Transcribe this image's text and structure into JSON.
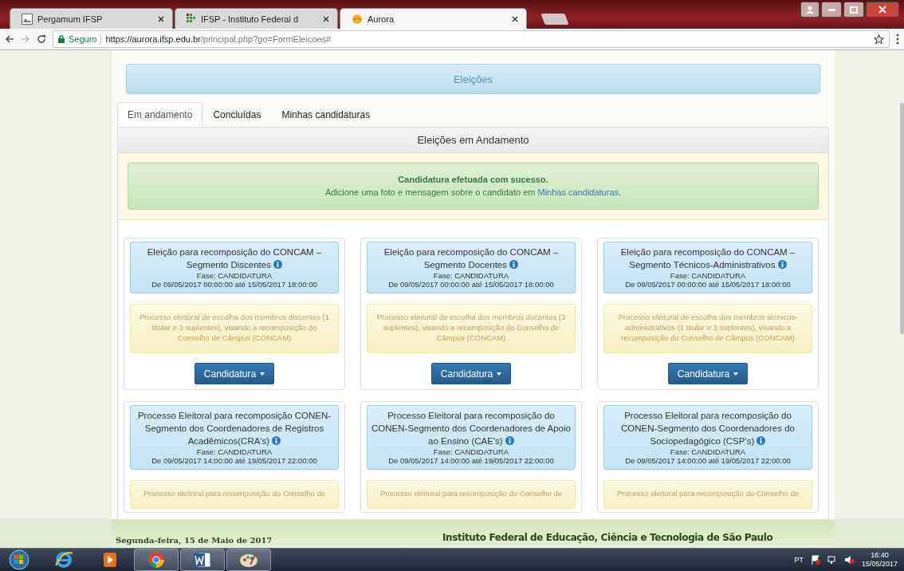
{
  "browser": {
    "tabs": [
      {
        "title": "Pergamum IFSP",
        "kind": "document",
        "selected": false
      },
      {
        "title": "IFSP - Instituto Federal d",
        "kind": "institute",
        "selected": false
      },
      {
        "title": "Aurora",
        "kind": "aurora",
        "selected": true
      }
    ],
    "address": {
      "security": "Seguro",
      "host": "https://aurora.ifsp.edu.br",
      "path": "/principal.php?go=FormEleicoes#"
    }
  },
  "page": {
    "header": "Eleições",
    "tabs": [
      {
        "label": "Em andamento",
        "selected": true
      },
      {
        "label": "Concluídas",
        "selected": false
      },
      {
        "label": "Minhas candidaturas",
        "selected": false
      }
    ],
    "panel_title": "Eleições em Andamento",
    "alert": {
      "title": "Candidatura efetuada com sucesso.",
      "message": "Adicione uma foto e mensagem sobre o candidato em ",
      "link": "Minhas candidaturas",
      "suffix": "."
    },
    "elections": [
      {
        "title": "Eleição para recomposição do CONCAM – Segmento Discentes",
        "phase": "Fase: CANDIDATURA",
        "period": "De 09/05/2017 00:00:00 até 15/05/2017 18:00:00",
        "description": "Processo eleitoral de escolha dos membros discentes (1 titular e 3 suplentes), visando a recomposição do Conselho de Câmpus (CONCAM)",
        "button": "Candidatura"
      },
      {
        "title": "Eleição para recomposição do CONCAM – Segmento Docentes",
        "phase": "Fase: CANDIDATURA",
        "period": "De 09/05/2017 00:00:00 até 15/05/2017 18:00:00",
        "description": "Processo eleitoral de escolha dos membros docentes (3 suplentes), visando a recomposição do Conselho de Câmpus (CONCAM)",
        "button": "Candidatura"
      },
      {
        "title": "Eleição para recomposição do CONCAM – Segmento Técnicos-Administrativos",
        "phase": "Fase: CANDIDATURA",
        "period": "De 09/05/2017 00:00:00 até 15/05/2017 18:00:00",
        "description": "Processo eleitoral de escolha dos membros técnicos-administrativos (1 titular e 3 suplentes), visando a recomposição do Conselho de Câmpus (CONCAM)",
        "button": "Candidatura"
      },
      {
        "title": "Processo Eleitoral para recomposição CONEN-Segmento dos Coordenadores de Registros Acadêmicos(CRA's)",
        "phase": "Fase: CANDIDATURA",
        "period": "De 09/05/2017 14:00:00 até 19/05/2017 22:00:00",
        "description": "Processo eleitoral para recomposição do Conselho de"
      },
      {
        "title": "Processo Eleitoral para recomposição do CONEN-Segmento dos Coordenadores de Apoio ao Ensino (CAE's)",
        "phase": "Fase: CANDIDATURA",
        "period": "De 09/05/2017 14:00:00 até 19/05/2017 22:00:00",
        "description": "Processo eleitoral para recomposição do Conselho de"
      },
      {
        "title": "Processo Eleitoral para recomposição do CONEN-Segmento dos Coordenadores do Sociopedagógico (CSP's)",
        "phase": "Fase: CANDIDATURA",
        "period": "De 09/05/2017 14:00:00 até 19/05/2017 22:00:00",
        "description": "Processo eleitoral para recomposição do Conselho de"
      }
    ]
  },
  "footer": {
    "date": "Segunda-feira, 15 de Maio de 2017",
    "institution": "Instituto Federal de Educação, Ciência e Tecnologia de São Paulo"
  },
  "taskbar": {
    "apps": [
      {
        "kind": "ie",
        "running": false
      },
      {
        "kind": "media",
        "running": false
      },
      {
        "kind": "chrome",
        "running": true
      },
      {
        "kind": "word",
        "running": true
      },
      {
        "kind": "paint",
        "running": true
      }
    ],
    "language": "PT",
    "time": "16:40",
    "date": "15/05/2017"
  }
}
